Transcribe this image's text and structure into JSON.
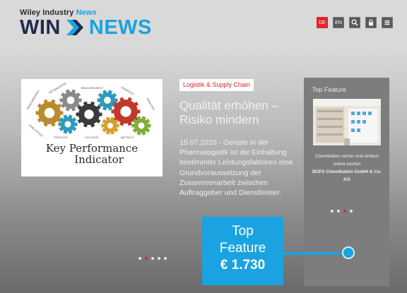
{
  "header": {
    "brand_prefix": "Wiley Industry ",
    "brand_prefix_accent": "News",
    "logo_left": "WIN",
    "logo_right": "NEWS",
    "lang_de": "DE",
    "lang_en": "EN"
  },
  "article": {
    "category": "Logistik & Supply Chain",
    "title": "Qualität erhöhen – Risiko mindern",
    "excerpt": "15.07.2020 - Gerade in der Pharmalogistik ist die Einhaltung bestimmter Leistungsfaktoren eine Grundvoraussetzung der Zusammenarbeit zwischen Auftraggeber und Dienstleister.",
    "image_caption_line1": "Key Performance",
    "image_caption_line2": "Indicator",
    "gear_words": [
      "PERFORMANCE",
      "OPTIMIZATION",
      "MEASUREMENT",
      "STRATEGY",
      "ANALYSIS",
      "EVALUATION",
      "PROCESS",
      "SUCCESS",
      "METRICS"
    ],
    "slide_count": 5,
    "active_slide": 1
  },
  "feature": {
    "heading": "Top Feature",
    "text": "Chemikalien sicher und einfach online kaufen",
    "company": "BÜFA Chemikalien GmbH & Co. KG",
    "slide_count": 4,
    "active_slide": 2
  },
  "callout": {
    "line1": "Top",
    "line2": "Feature",
    "price": "€ 1.730"
  },
  "colors": {
    "accent_blue": "#1aa3e0",
    "brand_navy": "#1f2b4b",
    "accent_red": "#e02628"
  }
}
